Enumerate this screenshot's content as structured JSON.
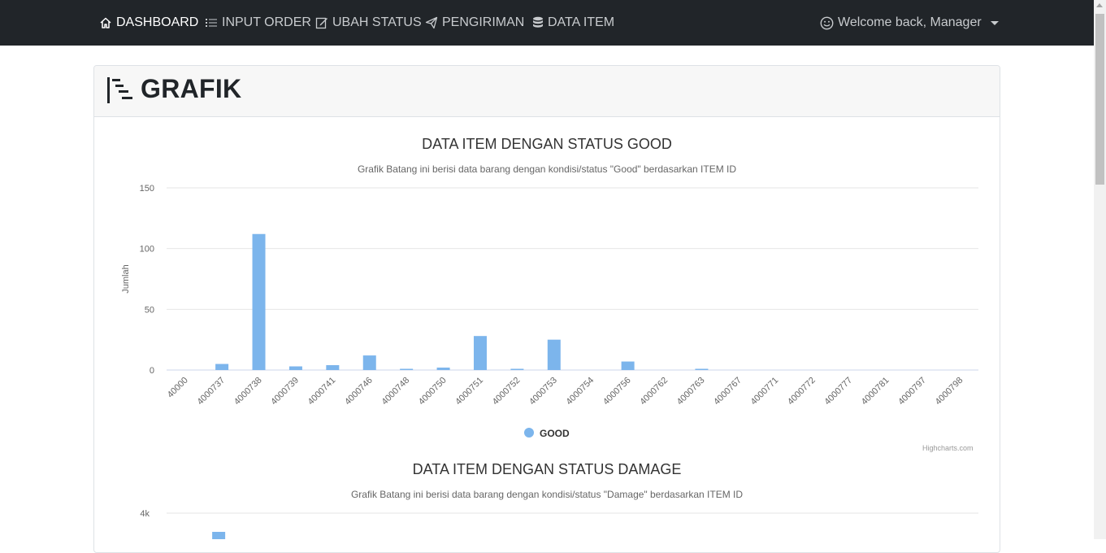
{
  "nav": {
    "items": [
      {
        "label": "DASHBOARD",
        "icon": "home-icon",
        "active": true
      },
      {
        "label": "INPUT ORDER",
        "icon": "list-icon",
        "active": false
      },
      {
        "label": "UBAH STATUS",
        "icon": "edit-icon",
        "active": false
      },
      {
        "label": "PENGIRIMAN",
        "icon": "send-icon",
        "active": false
      },
      {
        "label": "DATA ITEM",
        "icon": "database-icon",
        "active": false
      }
    ],
    "user_label": "Welcome back, Manager",
    "user_icon": "smiley-icon"
  },
  "card": {
    "title": "GRAFIK",
    "icon": "bar-list-icon"
  },
  "chart_data": [
    {
      "type": "bar",
      "title": "DATA ITEM DENGAN STATUS GOOD",
      "subtitle": "Grafik Batang ini berisi data barang dengan kondisi/status \"Good\" berdasarkan ITEM ID",
      "ylabel": "Jumlah",
      "xlabel": "",
      "ylim": [
        0,
        150
      ],
      "yticks": [
        "0",
        "50",
        "100",
        "150"
      ],
      "categories": [
        "40000",
        "4000737",
        "4000738",
        "4000739",
        "4000741",
        "4000746",
        "4000748",
        "4000750",
        "4000751",
        "4000752",
        "4000753",
        "4000754",
        "4000756",
        "4000762",
        "4000763",
        "4000767",
        "4000771",
        "4000772",
        "4000777",
        "4000781",
        "4000797",
        "4000798"
      ],
      "series": [
        {
          "name": "GOOD",
          "color": "#7cb5ec",
          "values": [
            0,
            5,
            112,
            3,
            4,
            12,
            1,
            2,
            28,
            1,
            25,
            0,
            7,
            0,
            1,
            0,
            0,
            0,
            0,
            0,
            0,
            0
          ]
        }
      ],
      "legend": "bottom-center",
      "grid": true,
      "credit": "Highcharts.com"
    },
    {
      "type": "bar",
      "title": "DATA ITEM DENGAN STATUS DAMAGE",
      "subtitle": "Grafik Batang ini berisi data barang dengan kondisi/status \"Damage\" berdasarkan ITEM ID",
      "yticks": [
        "4k"
      ],
      "ylim_top": 4000,
      "series": [
        {
          "color": "#7cb5ec",
          "visible_bar_category_index": 1
        }
      ]
    }
  ]
}
